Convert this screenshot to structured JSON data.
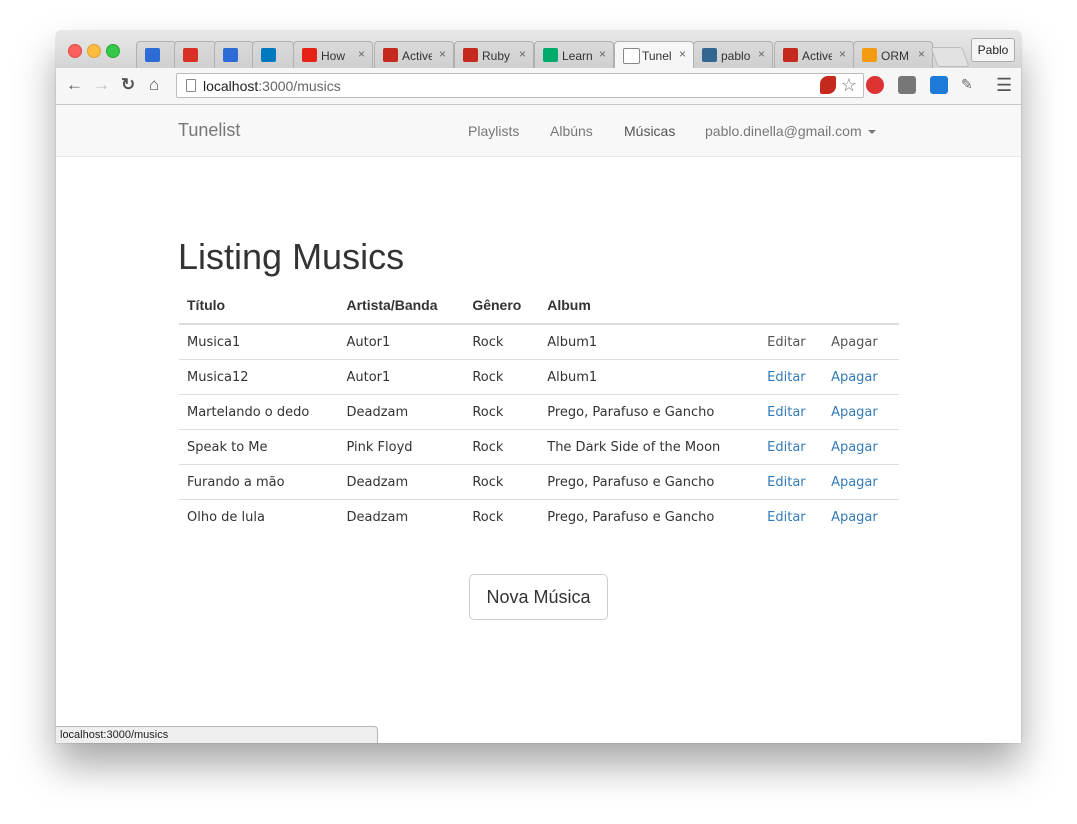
{
  "browser": {
    "tabs": [
      {
        "label": "",
        "icon": "inbox-icon",
        "color": "#2d6bd6"
      },
      {
        "label": "",
        "icon": "gmail-icon",
        "color": "#d93025"
      },
      {
        "label": "",
        "icon": "inbox-icon",
        "color": "#2d6bd6"
      },
      {
        "label": "",
        "icon": "trello-icon",
        "color": "#0079bf"
      },
      {
        "label": "How",
        "icon": "youtube-icon",
        "color": "#e62117"
      },
      {
        "label": "Active",
        "icon": "rails-icon",
        "color": "#c5281c"
      },
      {
        "label": "Ruby",
        "icon": "rails-icon",
        "color": "#c5281c"
      },
      {
        "label": "Learn",
        "icon": "medium-icon",
        "color": "#00ab6c"
      },
      {
        "label": "Tunel",
        "icon": "page-icon",
        "color": "#ffffff"
      },
      {
        "label": "pablo",
        "icon": "database-icon",
        "color": "#336791"
      },
      {
        "label": "Active",
        "icon": "rails-icon",
        "color": "#c5281c"
      },
      {
        "label": "ORM",
        "icon": "orm-icon",
        "color": "#f39c12"
      }
    ],
    "profile": "Pablo",
    "url_host": "localhost",
    "url_path": ":3000/musics",
    "status_text": "localhost:3000/musics"
  },
  "navbar": {
    "brand": "Tunelist",
    "links": [
      "Playlists",
      "Albúns",
      "Músicas"
    ],
    "user": "pablo.dinella@gmail.com"
  },
  "page": {
    "title": "Listing Musics",
    "columns": [
      "Título",
      "Artista/Banda",
      "Gênero",
      "Album",
      "",
      ""
    ],
    "rows": [
      [
        "Musica1",
        "Autor1",
        "Rock",
        "Album1",
        "Editar",
        "Apagar"
      ],
      [
        "Musica12",
        "Autor1",
        "Rock",
        "Album1",
        "Editar",
        "Apagar"
      ],
      [
        "Martelando o dedo",
        "Deadzam",
        "Rock",
        "Prego, Parafuso e Gancho",
        "Editar",
        "Apagar"
      ],
      [
        "Speak to Me",
        "Pink Floyd",
        "Rock",
        "The Dark Side of the Moon",
        "Editar",
        "Apagar"
      ],
      [
        "Furando a mão",
        "Deadzam",
        "Rock",
        "Prego, Parafuso e Gancho",
        "Editar",
        "Apagar"
      ],
      [
        "Olho de lula",
        "Deadzam",
        "Rock",
        "Prego, Parafuso e Gancho",
        "Editar",
        "Apagar"
      ]
    ],
    "new_button": "Nova Música"
  }
}
